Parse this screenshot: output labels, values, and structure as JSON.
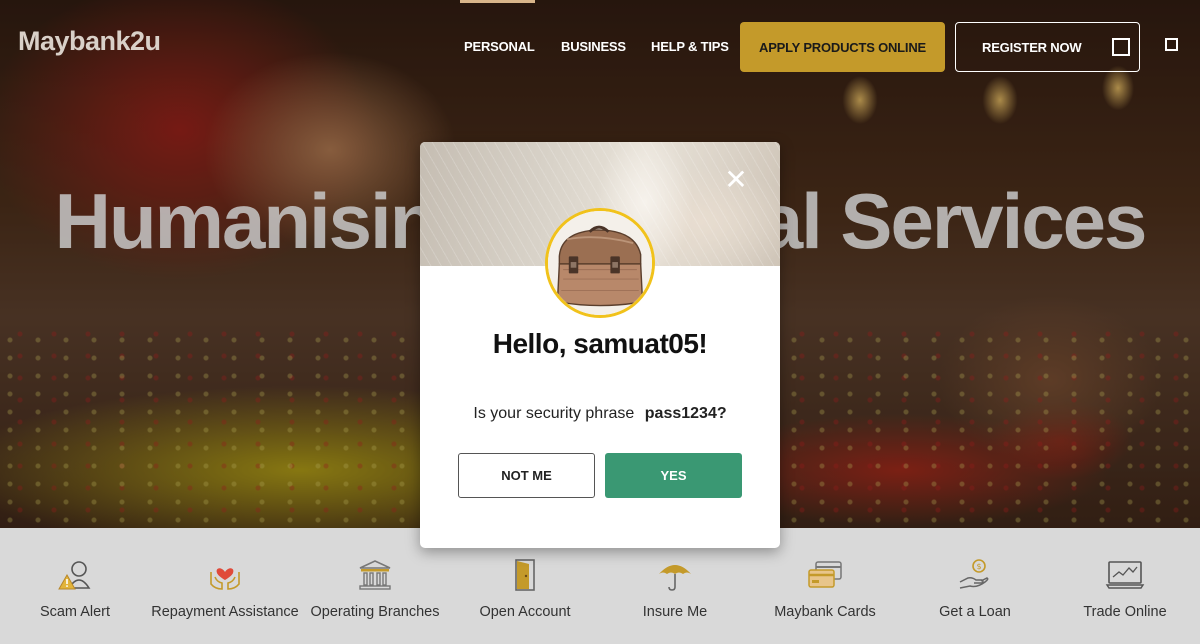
{
  "brand": {
    "logo_text": "Maybank2u"
  },
  "nav": {
    "items": [
      {
        "label": "PERSONAL"
      },
      {
        "label": "BUSINESS"
      },
      {
        "label": "HELP & TIPS"
      }
    ],
    "apply_label": "APPLY PRODUCTS ONLINE",
    "register_label": "REGISTER NOW",
    "colors": {
      "apply_bg": "#c49a2a",
      "active_indicator": "#d8b58a"
    }
  },
  "hero": {
    "title": "Humanising Financial Services"
  },
  "modal": {
    "greeting": "Hello, samuat05!",
    "question_prefix": "Is your security phrase",
    "security_phrase": "pass1234?",
    "not_me_label": "NOT ME",
    "yes_label": "YES",
    "avatar_icon": "treasure-chest-image",
    "colors": {
      "yes_bg": "#3a9873",
      "avatar_ring": "#f1c21b"
    }
  },
  "quick_links": [
    {
      "label": "Scam Alert",
      "icon": "scam-alert-icon"
    },
    {
      "label": "Repayment Assistance",
      "icon": "repayment-assistance-icon"
    },
    {
      "label": "Operating Branches",
      "icon": "bank-building-icon"
    },
    {
      "label": "Open Account",
      "icon": "door-icon"
    },
    {
      "label": "Insure Me",
      "icon": "umbrella-icon"
    },
    {
      "label": "Maybank Cards",
      "icon": "credit-card-icon"
    },
    {
      "label": "Get a Loan",
      "icon": "loan-hand-icon"
    },
    {
      "label": "Trade Online",
      "icon": "trading-monitor-icon"
    }
  ]
}
